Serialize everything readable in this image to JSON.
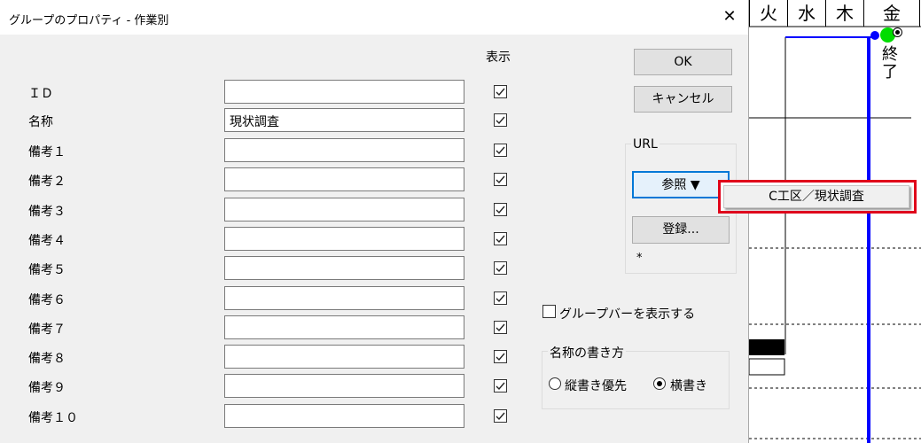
{
  "dialog": {
    "title": "グループのプロパティ - 作業別",
    "close": "✕",
    "display_header": "表示",
    "fields": [
      {
        "label": "ＩＤ",
        "value": "",
        "checked": true
      },
      {
        "label": "名称",
        "value": "現状調査",
        "checked": true
      },
      {
        "label": "備考１",
        "value": "",
        "checked": true
      },
      {
        "label": "備考２",
        "value": "",
        "checked": true
      },
      {
        "label": "備考３",
        "value": "",
        "checked": true
      },
      {
        "label": "備考４",
        "value": "",
        "checked": true
      },
      {
        "label": "備考５",
        "value": "",
        "checked": true
      },
      {
        "label": "備考６",
        "value": "",
        "checked": true
      },
      {
        "label": "備考７",
        "value": "",
        "checked": true
      },
      {
        "label": "備考８",
        "value": "",
        "checked": true
      },
      {
        "label": "備考９",
        "value": "",
        "checked": true
      },
      {
        "label": "備考１０",
        "value": "",
        "checked": true
      }
    ],
    "ok": "OK",
    "cancel": "キャンセル",
    "url": {
      "group_title": "URL",
      "browse": "参照 ▼",
      "register": "登録...",
      "note": "*"
    },
    "show_group_bar": {
      "label": "グループバーを表示する",
      "checked": false
    },
    "name_style": {
      "group_title": "名称の書き方",
      "options": [
        {
          "label": "縦書き優先",
          "selected": false
        },
        {
          "label": "横書き",
          "selected": true
        }
      ]
    }
  },
  "dropdown_menu": {
    "item": "C工区／現状調査"
  },
  "background": {
    "days": [
      "火",
      "水",
      "木",
      "金"
    ],
    "end_label": "終了",
    "colors": {
      "bar": "#0000ff",
      "milestone": "#00dd00",
      "highlight": "#e0001a"
    }
  }
}
